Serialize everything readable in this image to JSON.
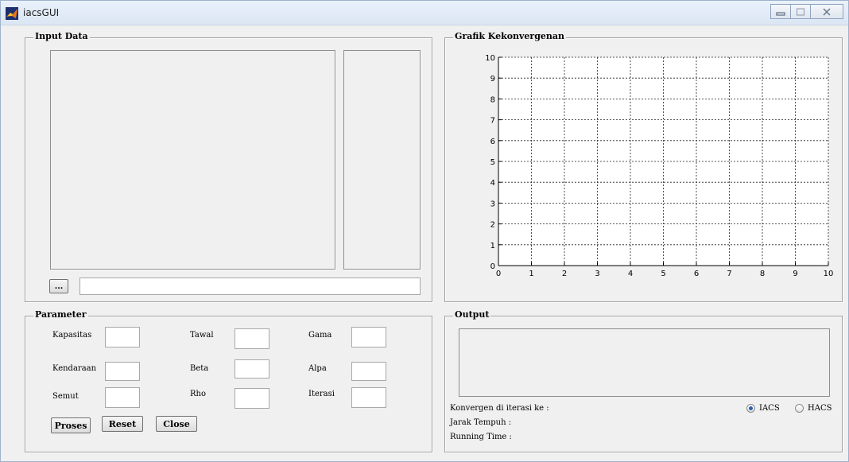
{
  "window": {
    "title": "iacsGUI"
  },
  "input_data": {
    "title": "Input Data",
    "browse_label": "...",
    "path_value": ""
  },
  "chart_panel": {
    "title": "Grafik Kekonvergenan"
  },
  "parameter": {
    "title": "Parameter",
    "kapasitas": {
      "label": "Kapasitas",
      "value": ""
    },
    "kendaraan": {
      "label": "Kendaraan",
      "value": ""
    },
    "semut": {
      "label": "Semut",
      "value": ""
    },
    "tawal": {
      "label": "Tawal",
      "value": ""
    },
    "beta": {
      "label": "Beta",
      "value": ""
    },
    "rho": {
      "label": "Rho",
      "value": ""
    },
    "gama": {
      "label": "Gama",
      "value": ""
    },
    "alpa": {
      "label": "Alpa",
      "value": ""
    },
    "iterasi": {
      "label": "Iterasi",
      "value": ""
    },
    "proses_label": "Proses",
    "reset_label": "Reset",
    "close_label": "Close"
  },
  "output": {
    "title": "Output",
    "konvergen_label": "Konvergen di iterasi ke :",
    "jarak_label": "Jarak Tempuh :",
    "running_label": "Running Time :",
    "iacs_label": "IACS",
    "hacs_label": "HACS",
    "selected": "IACS"
  },
  "chart_data": {
    "type": "line",
    "title": "",
    "xlabel": "",
    "ylabel": "",
    "xlim": [
      0,
      10
    ],
    "ylim": [
      0,
      10
    ],
    "xticks": [
      0,
      1,
      2,
      3,
      4,
      5,
      6,
      7,
      8,
      9,
      10
    ],
    "yticks": [
      0,
      1,
      2,
      3,
      4,
      5,
      6,
      7,
      8,
      9,
      10
    ],
    "grid": true,
    "grid_style": "dotted",
    "series": []
  }
}
